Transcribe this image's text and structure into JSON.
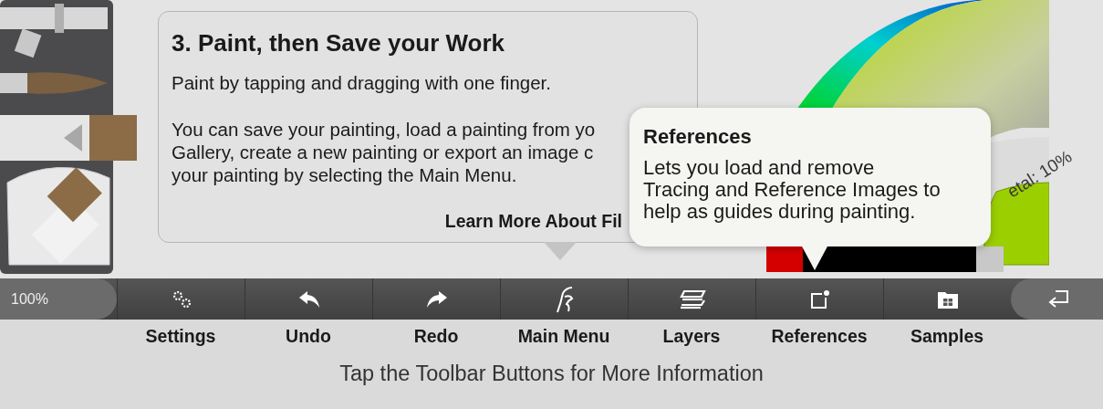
{
  "tip_card": {
    "title": "3. Paint, then Save your Work",
    "paragraphs": [
      "Paint by tapping and dragging with one finger.",
      [
        "You can save your painting, load a painting from yo",
        "Gallery, create a new painting or export an image c",
        "your painting by selecting the Main Menu."
      ]
    ],
    "link": "Learn More About Fil"
  },
  "tooltip": {
    "title": "References",
    "lines": [
      "Lets you load and remove",
      "Tracing and Reference Images to",
      "help as guides during painting."
    ]
  },
  "metal_label": "etal: 10%",
  "toolbar": {
    "zoom": "100%",
    "buttons": [
      {
        "kind": "gears",
        "label": "Settings"
      },
      {
        "kind": "undo",
        "label": "Undo"
      },
      {
        "kind": "redo",
        "label": "Redo"
      },
      {
        "kind": "brush",
        "label": "Main Menu"
      },
      {
        "kind": "layers",
        "label": "Layers"
      },
      {
        "kind": "frame",
        "label": "References"
      },
      {
        "kind": "folder",
        "label": "Samples"
      }
    ]
  },
  "hint": "Tap the Toolbar Buttons for More Information"
}
